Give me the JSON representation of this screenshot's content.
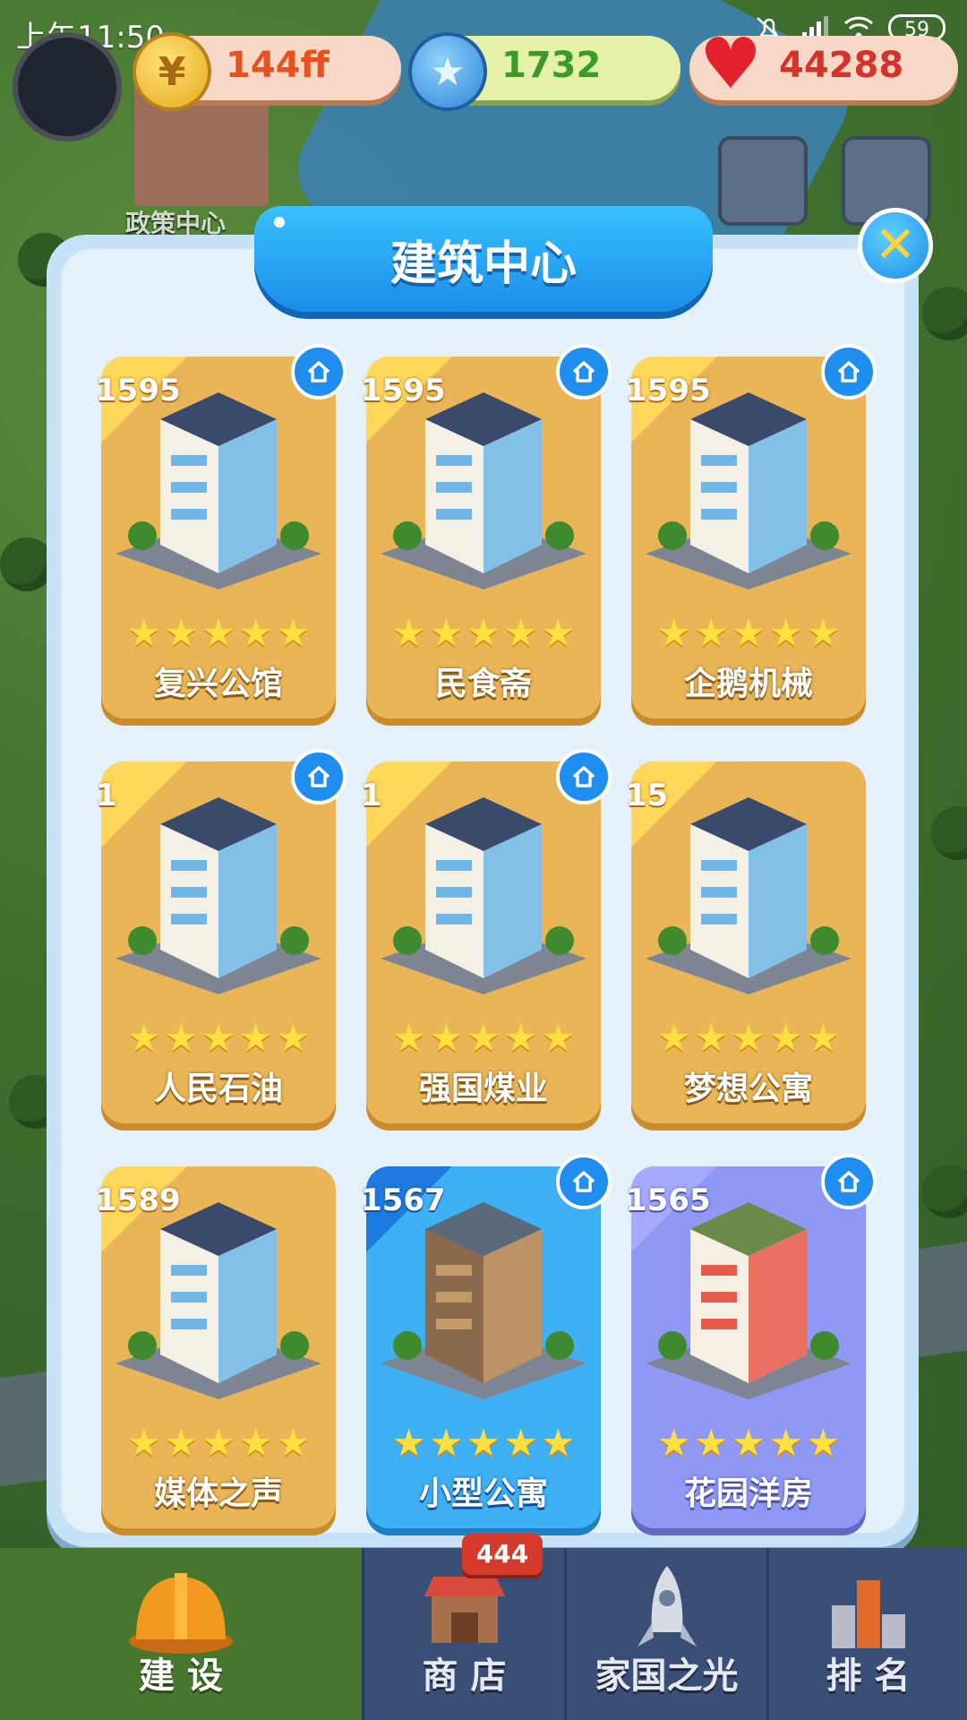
{
  "status_bar": {
    "time": "上午11:50",
    "battery": "59"
  },
  "resources": {
    "coin": {
      "icon": "coin-icon",
      "value": "144ff"
    },
    "star": {
      "icon": "star-coin-icon",
      "value": "1732"
    },
    "heart": {
      "icon": "heart-icon",
      "value": "44288"
    }
  },
  "background": {
    "policy_center_label": "政策中心"
  },
  "modal": {
    "title": "建筑中心",
    "close_icon": "close-icon"
  },
  "buildings": [
    {
      "price": "1595",
      "name": "复兴公馆",
      "stars": 5,
      "style": "gold",
      "has_home_button": true
    },
    {
      "price": "1595",
      "name": "民食斋",
      "stars": 5,
      "style": "gold",
      "has_home_button": true
    },
    {
      "price": "1595",
      "name": "企鹅机械",
      "stars": 5,
      "style": "gold",
      "has_home_button": true
    },
    {
      "price": "1",
      "name": "人民石油",
      "stars": 5,
      "style": "gold",
      "has_home_button": true
    },
    {
      "price": "1",
      "name": "强国煤业",
      "stars": 5,
      "style": "gold",
      "has_home_button": true
    },
    {
      "price": "15",
      "name": "梦想公寓",
      "stars": 5,
      "style": "gold",
      "has_home_button": false
    },
    {
      "price": "1589",
      "name": "媒体之声",
      "stars": 5,
      "style": "gold",
      "has_home_button": false
    },
    {
      "price": "1567",
      "name": "小型公寓",
      "stars": 5,
      "style": "blue",
      "has_home_button": true
    },
    {
      "price": "1565",
      "name": "花园洋房",
      "stars": 5,
      "style": "purple",
      "has_home_button": true
    }
  ],
  "bottom_nav": {
    "badge": "444",
    "items": [
      {
        "label": "建 设",
        "icon": "hardhat-icon",
        "active": true
      },
      {
        "label": "商 店",
        "icon": "shop-icon",
        "active": false
      },
      {
        "label": "家国之光",
        "icon": "rocket-icon",
        "active": false
      },
      {
        "label": "排 名",
        "icon": "ranking-icon",
        "active": false
      }
    ]
  },
  "colors": {
    "card_gold": "#e9b556",
    "card_blue": "#3fb0f3",
    "card_purple": "#8f98f5",
    "banner_blue": "#1a8ee8",
    "star_yellow": "#ffe040"
  }
}
